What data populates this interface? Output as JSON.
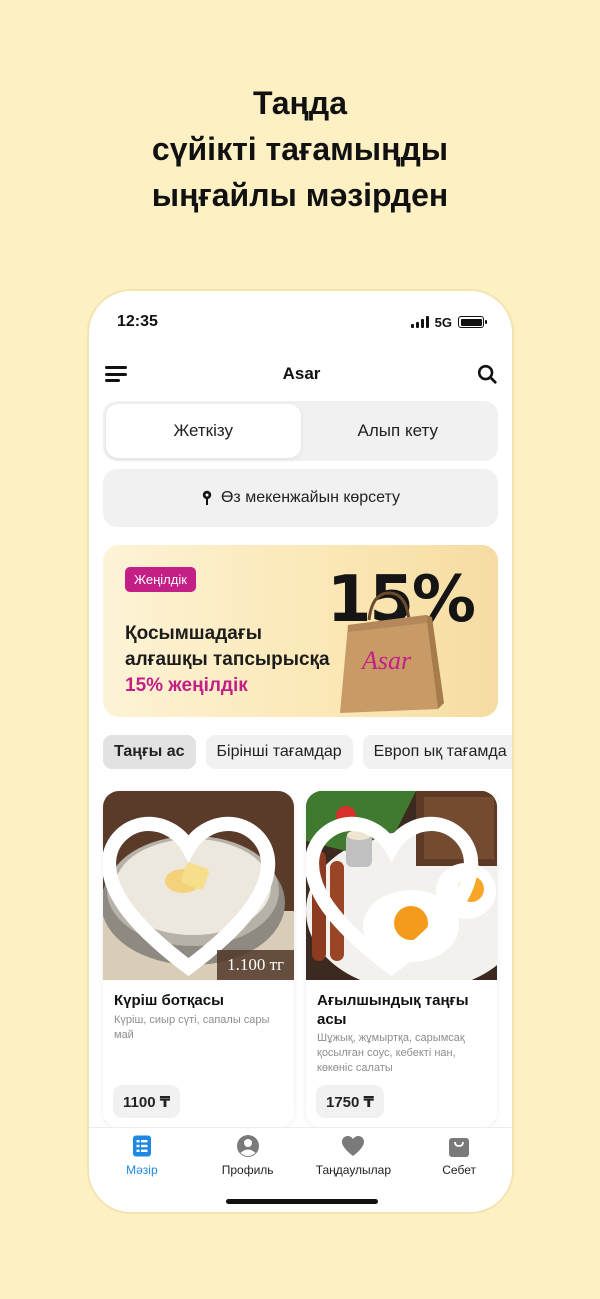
{
  "headline": [
    "Таңда",
    "сүйікті тағамыңды",
    "ыңғайлы мәзірден"
  ],
  "status": {
    "time": "12:35",
    "network": "5G"
  },
  "appbar": {
    "title": "Asar"
  },
  "segments": [
    {
      "label": "Жеткізу",
      "active": true
    },
    {
      "label": "Алып кету",
      "active": false
    }
  ],
  "address": {
    "label": "Өз мекенжайын көрсету"
  },
  "promo": {
    "badge": "Жеңілдік",
    "line1": "Қосымшадағы",
    "line2": "алғашқы тапсырысқа",
    "line3": "15% жеңілдік",
    "percent": "15%",
    "logo_text": "Asar",
    "colors": {
      "accent": "#C41F86"
    }
  },
  "categories": [
    {
      "label": "Таңғы ас",
      "active": true
    },
    {
      "label": "Бірінші тағамдар",
      "active": false
    },
    {
      "label": "Европ ық тағамда",
      "active": false
    }
  ],
  "products": [
    {
      "title": "Күріш ботқасы",
      "description": "Күріш, сиыр сүті, сапалы сары май",
      "image_price": "1.100 тг",
      "price": "1100 ₸"
    },
    {
      "title": "Ағылшындық таңғы асы",
      "description": "Шұжық, жұмыртқа, сарымсақ қосылған соус, кебектi нан, көкөніс салаты",
      "price": "1750 ₸"
    }
  ],
  "tabbar": [
    {
      "label": "Мәзір",
      "icon": "menu-book-icon",
      "active": true
    },
    {
      "label": "Профиль",
      "icon": "profile-icon",
      "active": false
    },
    {
      "label": "Таңдаулылар",
      "icon": "heart-icon",
      "active": false
    },
    {
      "label": "Себет",
      "icon": "bag-icon",
      "active": false
    }
  ],
  "colors": {
    "background": "#FDF0C2",
    "active_tab": "#1E88E5"
  }
}
